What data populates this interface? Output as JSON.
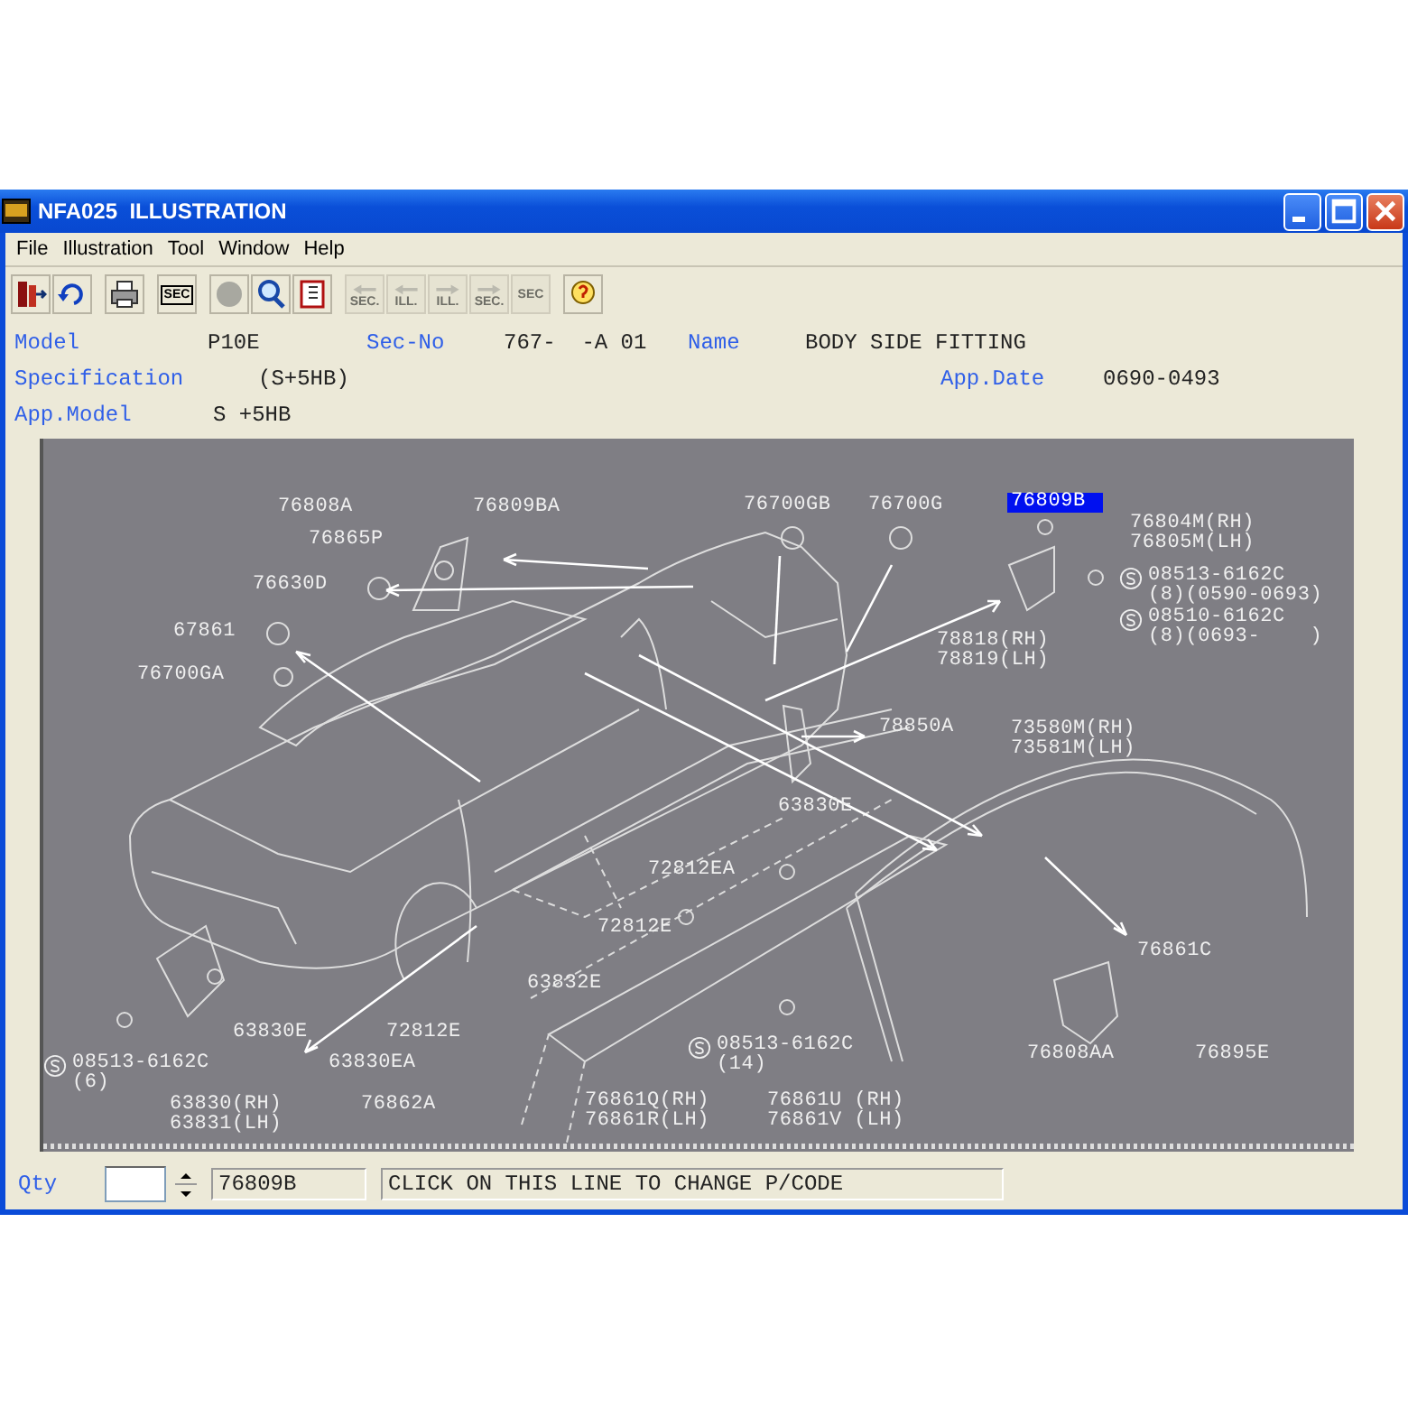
{
  "window": {
    "title": "NFA025  ILLUSTRATION"
  },
  "menu": [
    "File",
    "Illustration",
    "Tool",
    "Window",
    "Help"
  ],
  "toolbar": [
    {
      "kind": "exit"
    },
    {
      "kind": "undo"
    },
    {
      "kind": "print"
    },
    {
      "kind": "sec",
      "label": "SEC"
    },
    {
      "kind": "circle"
    },
    {
      "kind": "search"
    },
    {
      "kind": "book"
    },
    {
      "kind": "nav-left",
      "label": "SEC.",
      "disabled": true
    },
    {
      "kind": "nav-left",
      "label": "ILL.",
      "disabled": true
    },
    {
      "kind": "nav-right",
      "label": "ILL.",
      "disabled": true
    },
    {
      "kind": "nav-right",
      "label": "SEC.",
      "disabled": true
    },
    {
      "kind": "nav-query",
      "label": "SEC",
      "disabled": true
    },
    {
      "kind": "help"
    }
  ],
  "info": {
    "model_label": "Model",
    "model": "P10E",
    "sec_no_label": "Sec-No",
    "sec_no": "767-  -A 01",
    "name_label": "Name",
    "name": "BODY SIDE FITTING",
    "specification_label": "Specification",
    "specification": "(S+5HB)",
    "app_date_label": "App.Date",
    "app_date": "0690-0493",
    "app_model_label": "App.Model",
    "app_model": "S +5HB"
  },
  "callouts": [
    {
      "kind": "part",
      "lines": [
        "76808A"
      ],
      "selected": false
    },
    {
      "kind": "part",
      "lines": [
        "76809BA"
      ],
      "selected": false
    },
    {
      "kind": "part",
      "lines": [
        "76865P"
      ],
      "selected": false
    },
    {
      "kind": "part",
      "lines": [
        "76630D"
      ],
      "selected": false
    },
    {
      "kind": "part",
      "lines": [
        "67861"
      ],
      "selected": false
    },
    {
      "kind": "part",
      "lines": [
        "76700GA"
      ],
      "selected": false
    },
    {
      "kind": "part",
      "lines": [
        "76700GB"
      ],
      "selected": false
    },
    {
      "kind": "part",
      "lines": [
        "76700G"
      ],
      "selected": false
    },
    {
      "kind": "part",
      "lines": [
        "76809B"
      ],
      "selected": true
    },
    {
      "kind": "part",
      "lines": [
        "76804M(RH)",
        "76805M(LH)"
      ],
      "selected": false
    },
    {
      "kind": "standard",
      "lines": [
        "08513-6162C",
        "(8)(0590-0693)"
      ],
      "selected": false
    },
    {
      "kind": "standard",
      "lines": [
        "08510-6162C",
        "(8)(0693-    )"
      ],
      "selected": false
    },
    {
      "kind": "part",
      "lines": [
        "78818(RH)",
        "78819(LH)"
      ],
      "selected": false
    },
    {
      "kind": "part",
      "lines": [
        "78850A"
      ],
      "selected": false
    },
    {
      "kind": "part",
      "lines": [
        "73580M(RH)",
        "73581M(LH)"
      ],
      "selected": false
    },
    {
      "kind": "part",
      "lines": [
        "63830E"
      ],
      "selected": false
    },
    {
      "kind": "part",
      "lines": [
        "72812EA"
      ],
      "selected": false
    },
    {
      "kind": "part",
      "lines": [
        "72812E"
      ],
      "selected": false
    },
    {
      "kind": "part",
      "lines": [
        "63832E"
      ],
      "selected": false
    },
    {
      "kind": "part",
      "lines": [
        "63830E"
      ],
      "selected": false
    },
    {
      "kind": "part",
      "lines": [
        "72812E"
      ],
      "selected": false
    },
    {
      "kind": "standard",
      "lines": [
        "08513-6162C",
        "(6)"
      ],
      "selected": false
    },
    {
      "kind": "part",
      "lines": [
        "63830EA"
      ],
      "selected": false
    },
    {
      "kind": "part",
      "lines": [
        "63830(RH)",
        "63831(LH)"
      ],
      "selected": false
    },
    {
      "kind": "part",
      "lines": [
        "76862A"
      ],
      "selected": false
    },
    {
      "kind": "part",
      "lines": [
        "76861Q(RH)",
        "76861R(LH)"
      ],
      "selected": false
    },
    {
      "kind": "standard",
      "lines": [
        "08513-6162C",
        "(14)"
      ],
      "selected": false
    },
    {
      "kind": "part",
      "lines": [
        "76861U (RH)",
        "76861V (LH)"
      ],
      "selected": false
    },
    {
      "kind": "part",
      "lines": [
        "76861C"
      ],
      "selected": false
    },
    {
      "kind": "part",
      "lines": [
        "76808AA"
      ],
      "selected": false
    },
    {
      "kind": "part",
      "lines": [
        "76895E"
      ],
      "selected": false
    }
  ],
  "footer": {
    "qty_label": "Qty",
    "part_code": "76809B",
    "message": "CLICK ON THIS LINE TO CHANGE P/CODE"
  }
}
